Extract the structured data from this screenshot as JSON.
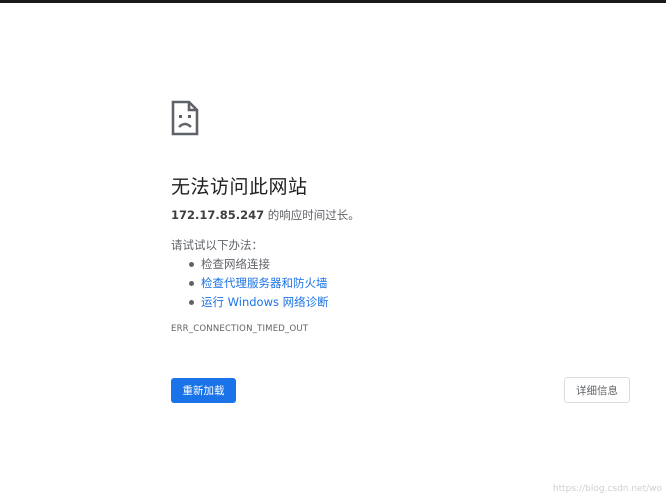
{
  "error_page": {
    "title": "无法访问此网站",
    "host": "172.17.85.247",
    "summary_suffix": " 的响应时间过长。",
    "suggestions_heading": "请试试以下办法：",
    "suggestions": [
      {
        "label": "检查网络连接",
        "is_link": false
      },
      {
        "label": "检查代理服务器和防火墙",
        "is_link": true
      },
      {
        "label": "运行 Windows 网络诊断",
        "is_link": true
      }
    ],
    "error_code": "ERR_CONNECTION_TIMED_OUT",
    "reload_label": "重新加载",
    "details_label": "详细信息"
  },
  "watermark": "https://blog.csdn.net/wo",
  "colors": {
    "primary_blue": "#1a73e8",
    "text_gray": "#5f6368",
    "title_dark": "#202124"
  },
  "icons": {
    "main": "sad-page-icon"
  }
}
